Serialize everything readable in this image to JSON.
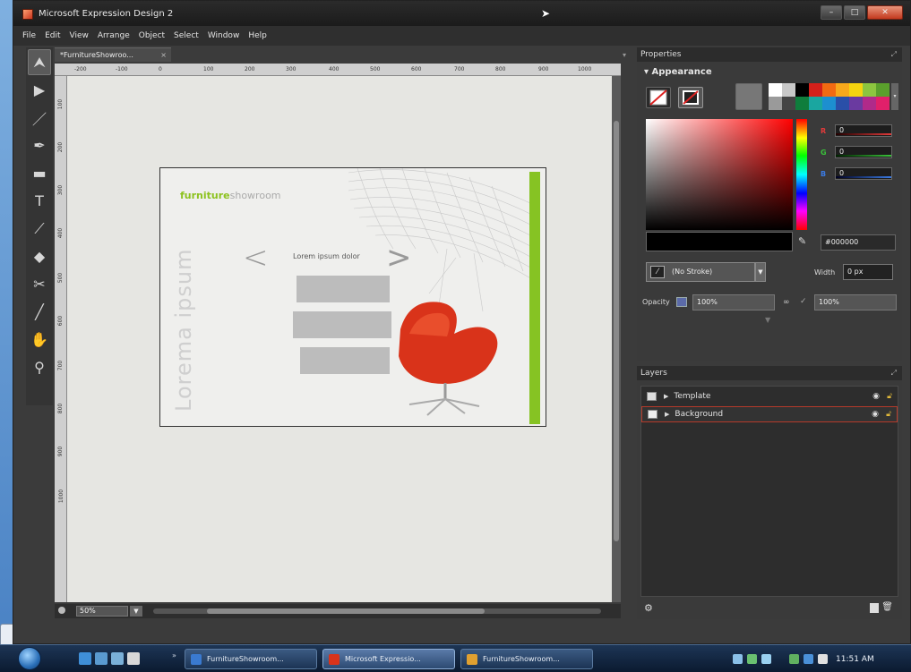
{
  "window": {
    "title": "Microsoft Expression Design 2",
    "controls": {
      "minimize": "–",
      "maximize": "□",
      "close": "✕"
    }
  },
  "menu": [
    "File",
    "Edit",
    "View",
    "Arrange",
    "Object",
    "Select",
    "Window",
    "Help"
  ],
  "document": {
    "tab_title": "*FurnitureShowroo...",
    "tab_close": "×",
    "zoom": "50%",
    "ruler_h": [
      "-200",
      "-100",
      "0",
      "100",
      "200",
      "300",
      "400",
      "500",
      "600",
      "700",
      "800",
      "900",
      "1000"
    ],
    "ruler_v": [
      "100",
      "200",
      "300",
      "400",
      "500",
      "600",
      "700",
      "800",
      "900",
      "1000"
    ]
  },
  "artwork": {
    "brand_bold": "furniture",
    "brand_light": "showroom",
    "vertical_title": "Lorema ipsum",
    "caption": "Lorem ipsum dolor",
    "arrow_left": "<",
    "arrow_right": ">",
    "accent_green": "#86c323",
    "chair_color": "#d9331a"
  },
  "properties": {
    "header": "Properties",
    "section": "Appearance",
    "swatches": [
      "#ffffff",
      "#c8c8c8",
      "#000000",
      "#d4201a",
      "#f26a12",
      "#f7a81b",
      "#f5d40f",
      "#8cc63f",
      "#5aa02c",
      "#9a9a9a",
      "#444444",
      "#0f7d3c",
      "#1aa6a0",
      "#1d8fd0",
      "#2a4fa8",
      "#6a3aa0",
      "#b02a8a",
      "#e0206a"
    ],
    "rgb": [
      {
        "label": "R",
        "value": "0",
        "color": "#e23a3a"
      },
      {
        "label": "G",
        "value": "0",
        "color": "#3ac23a"
      },
      {
        "label": "B",
        "value": "0",
        "color": "#3a7ae2"
      }
    ],
    "hex": "#000000",
    "stroke": "(No Stroke)",
    "width_label": "Width",
    "width_value": "0 px",
    "opacity_label": "Opacity",
    "opacity_value": "100%",
    "opacity_value2": "100%"
  },
  "layers": {
    "header": "Layers",
    "items": [
      {
        "name": "Template",
        "selected": false
      },
      {
        "name": "Background",
        "selected": true
      }
    ]
  },
  "taskbar": {
    "tasks": [
      {
        "label": "FurnitureShowroom...",
        "icon_color": "#3a7ad0",
        "active": false
      },
      {
        "label": "Microsoft Expressio...",
        "icon_color": "#d9331a",
        "active": true
      },
      {
        "label": "FurnitureShowroom...",
        "icon_color": "#e0a030",
        "active": false
      }
    ],
    "clock": "11:51 AM"
  },
  "desktop": {
    "close_label": "X"
  }
}
